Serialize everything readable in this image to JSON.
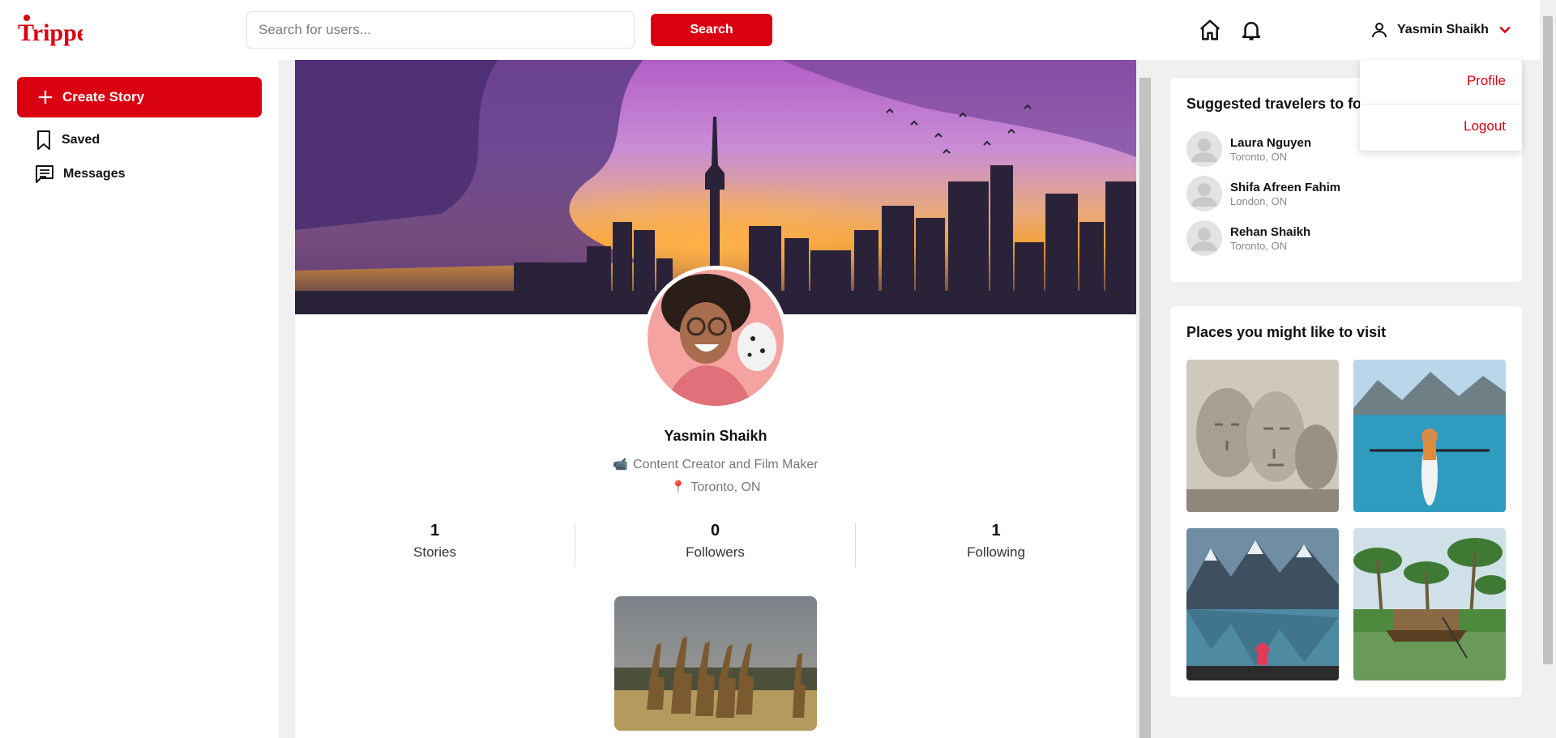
{
  "brand": {
    "name": "Trippeo",
    "accent": "#d90012"
  },
  "header": {
    "search_placeholder": "Search for users...",
    "search_button": "Search",
    "icons": [
      "home-icon",
      "bell-icon",
      "user-icon",
      "chevron-down-icon"
    ],
    "user_name": "Yasmin Shaikh"
  },
  "dropdown": {
    "items": [
      "Profile",
      "Logout"
    ]
  },
  "sidebar": {
    "create_label": "Create Story",
    "items": [
      {
        "label": "Saved",
        "icon": "bookmark-icon"
      },
      {
        "label": "Messages",
        "icon": "message-icon"
      }
    ]
  },
  "profile": {
    "name": "Yasmin Shaikh",
    "bio_emoji": "📹",
    "bio": "Content Creator and Film Maker",
    "location_emoji": "📍",
    "location": "Toronto, ON",
    "stats": [
      {
        "value": "1",
        "label": "Stories"
      },
      {
        "value": "0",
        "label": "Followers"
      },
      {
        "value": "1",
        "label": "Following"
      }
    ]
  },
  "suggested": {
    "title": "Suggested travelers to fo",
    "travelers": [
      {
        "name": "Laura Nguyen",
        "location": "Toronto, ON"
      },
      {
        "name": "Shifa Afreen Fahim",
        "location": "London, ON"
      },
      {
        "name": "Rehan Shaikh",
        "location": "Toronto, ON"
      }
    ]
  },
  "places": {
    "title": "Places you might like to visit",
    "images": [
      "mount-rushmore",
      "kayak-lake",
      "mountain-lake",
      "tropical-houseboat"
    ]
  }
}
